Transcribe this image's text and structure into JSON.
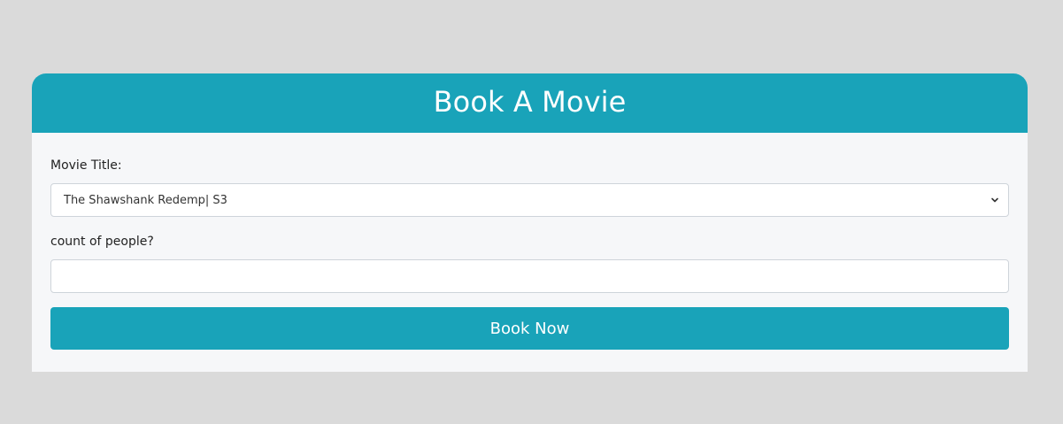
{
  "form": {
    "header_title": "Book A Movie",
    "movie_title_label": "Movie Title:",
    "movie_select_value": "The Shawshank Redemp| S3",
    "count_label": "count of people?",
    "count_value": "",
    "submit_label": "Book Now"
  },
  "colors": {
    "accent": "#19a3b9",
    "page_background": "#dadada",
    "card_background": "#f6f7f9"
  },
  "icons": {
    "select_arrow": "chevron-down-icon"
  }
}
